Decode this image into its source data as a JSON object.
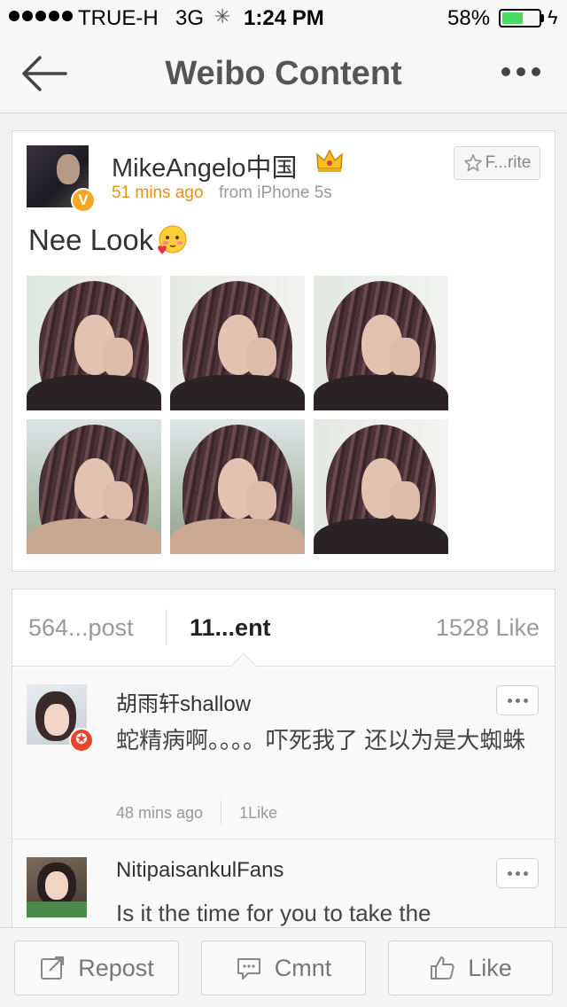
{
  "status_bar": {
    "carrier": "TRUE-H",
    "network": "3G",
    "time": "1:24 PM",
    "battery_percent": "58%",
    "battery_level": 0.58
  },
  "nav": {
    "title": "Weibo Content"
  },
  "post": {
    "username": "MikeAngelo中国",
    "time_ago": "51 mins ago",
    "source": "from iPhone 5s",
    "favorite_label": "F...rite",
    "text": "Nee Look",
    "photo_count": 6
  },
  "stats": {
    "repost": "564...post",
    "comment": "11...ent",
    "like": "1528 Like"
  },
  "comments": [
    {
      "username": "胡雨轩shallow",
      "text": "蛇精病啊。。。。吓死我了 还以为是大蜘蛛",
      "time_ago": "48 mins ago",
      "likes": "1Like"
    },
    {
      "username": "NitipaisankulFans",
      "text": "Is it the time for you to take the"
    }
  ],
  "toolbar": {
    "repost": "Repost",
    "comment": "Cmnt",
    "like": "Like"
  },
  "colors": {
    "accent_orange": "#e89018",
    "verified_badge": "#f5a623",
    "battery_green": "#4cd964",
    "fan_badge_red": "#e8452c"
  }
}
